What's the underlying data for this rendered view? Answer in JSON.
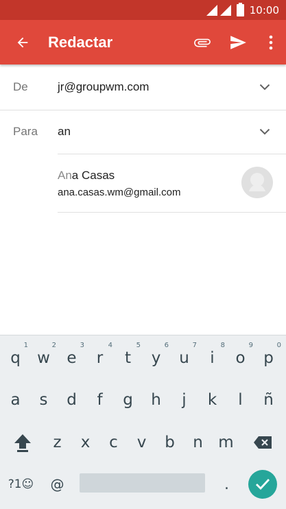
{
  "status_bar": {
    "time": "10:00",
    "icons": [
      "signal-icon",
      "signal-icon",
      "battery-icon"
    ]
  },
  "app_bar": {
    "title": "Redactar",
    "icons": [
      "back-arrow-icon",
      "attach-icon",
      "send-icon",
      "more-vert-icon"
    ],
    "color": "#e0483b",
    "status_color": "#c2362a"
  },
  "compose": {
    "from_label": "De",
    "from_value": "jr@groupwm.com",
    "to_label": "Para",
    "to_value": "an"
  },
  "suggestion": {
    "name_match": "An",
    "name_rest": "a Casas",
    "email": "ana.casas.wm@gmail.com"
  },
  "keyboard": {
    "row1": [
      {
        "k": "q",
        "h": "1"
      },
      {
        "k": "w",
        "h": "2"
      },
      {
        "k": "e",
        "h": "3"
      },
      {
        "k": "r",
        "h": "4"
      },
      {
        "k": "t",
        "h": "5"
      },
      {
        "k": "y",
        "h": "6"
      },
      {
        "k": "u",
        "h": "7"
      },
      {
        "k": "i",
        "h": "8"
      },
      {
        "k": "o",
        "h": "9"
      },
      {
        "k": "p",
        "h": "0"
      }
    ],
    "row2": [
      "a",
      "s",
      "d",
      "f",
      "g",
      "h",
      "j",
      "k",
      "l",
      "ñ"
    ],
    "row3": [
      "z",
      "x",
      "c",
      "v",
      "b",
      "n",
      "m"
    ],
    "symbols_label": "?1☺",
    "at_label": "@",
    "period_label": ".",
    "accent_color": "#26a69a"
  }
}
